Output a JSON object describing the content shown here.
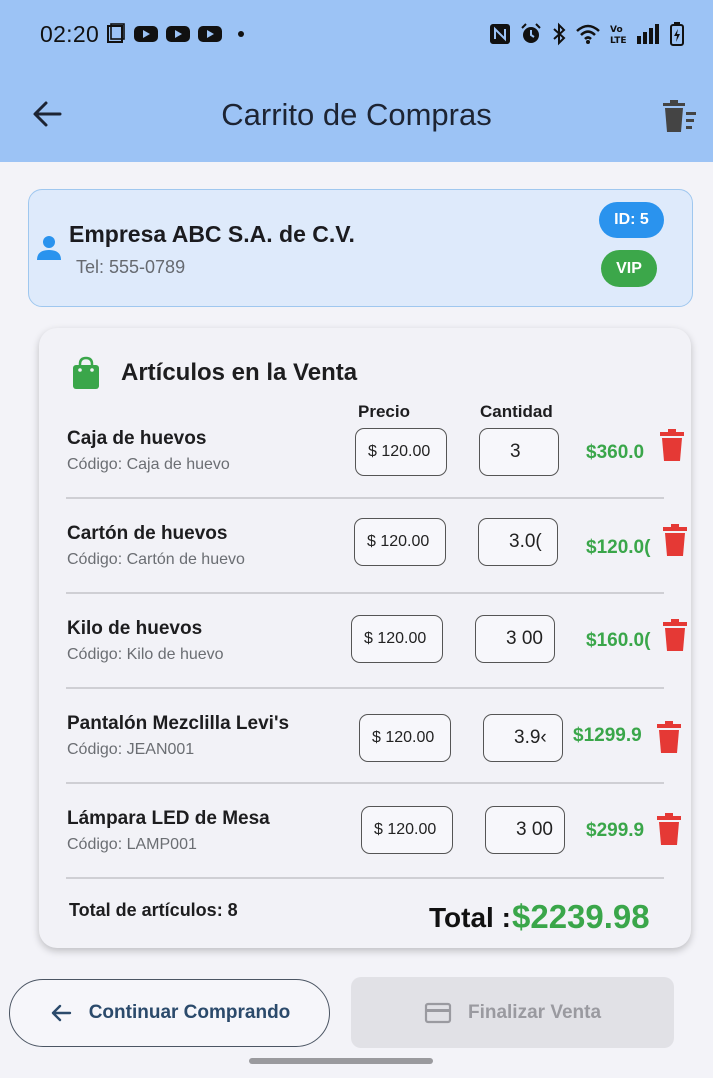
{
  "status_bar": {
    "time": "02:20",
    "left_icons": [
      "screenshot-icon",
      "youtube-icon",
      "youtube-icon",
      "youtube-icon",
      "dot-icon"
    ],
    "right_icons": [
      "nfc-icon",
      "alarm-icon",
      "bluetooth-icon",
      "wifi-icon",
      "volte-icon",
      "signal-icon",
      "battery-icon"
    ]
  },
  "appbar": {
    "title": "Carrito de Compras"
  },
  "client": {
    "name": "Empresa ABC S.A. de C.V.",
    "phone": "Tel: 555-0789",
    "id_badge": "ID: 5",
    "tier_badge": "VIP"
  },
  "items_section": {
    "title": "Artículos en la Venta",
    "col_price": "Precio",
    "col_quantity": "Cantidad",
    "rows": [
      {
        "name": "Caja de huevos",
        "code": "Código: Caja de huevo",
        "price": "$ 120.00",
        "quantity": "3",
        "subtotal": "$360.0"
      },
      {
        "name": "Cartón de huevos",
        "code": "Código: Cartón de huevo",
        "price": "$ 120.00",
        "quantity": "3.0(",
        "subtotal": "$120.0("
      },
      {
        "name": "Kilo de huevos",
        "code": "Código: Kilo de huevo",
        "price": "$ 120.00",
        "quantity": "3 00",
        "subtotal": "$160.0("
      },
      {
        "name": "Pantalón Mezclilla Levi's",
        "code": "Código: JEAN001",
        "price": "$ 120.00",
        "quantity": "3.9‹",
        "subtotal": "$1299.9"
      },
      {
        "name": "Lámpara LED de Mesa",
        "code": "Código: LAMP001",
        "price": "$ 120.00",
        "quantity": "3 00",
        "subtotal": "$299.9"
      }
    ],
    "total_items": "Total de artículos: 8",
    "total_label": "Total :",
    "total_value": "$2239.98"
  },
  "actions": {
    "continue_label": "Continuar Comprando",
    "finalize_label": "Finalizar Venta"
  },
  "colors": {
    "appbar": "#9cc3f5",
    "accent_green": "#3aa64a",
    "badge_blue": "#2a93ee",
    "delete_red": "#e53935"
  }
}
